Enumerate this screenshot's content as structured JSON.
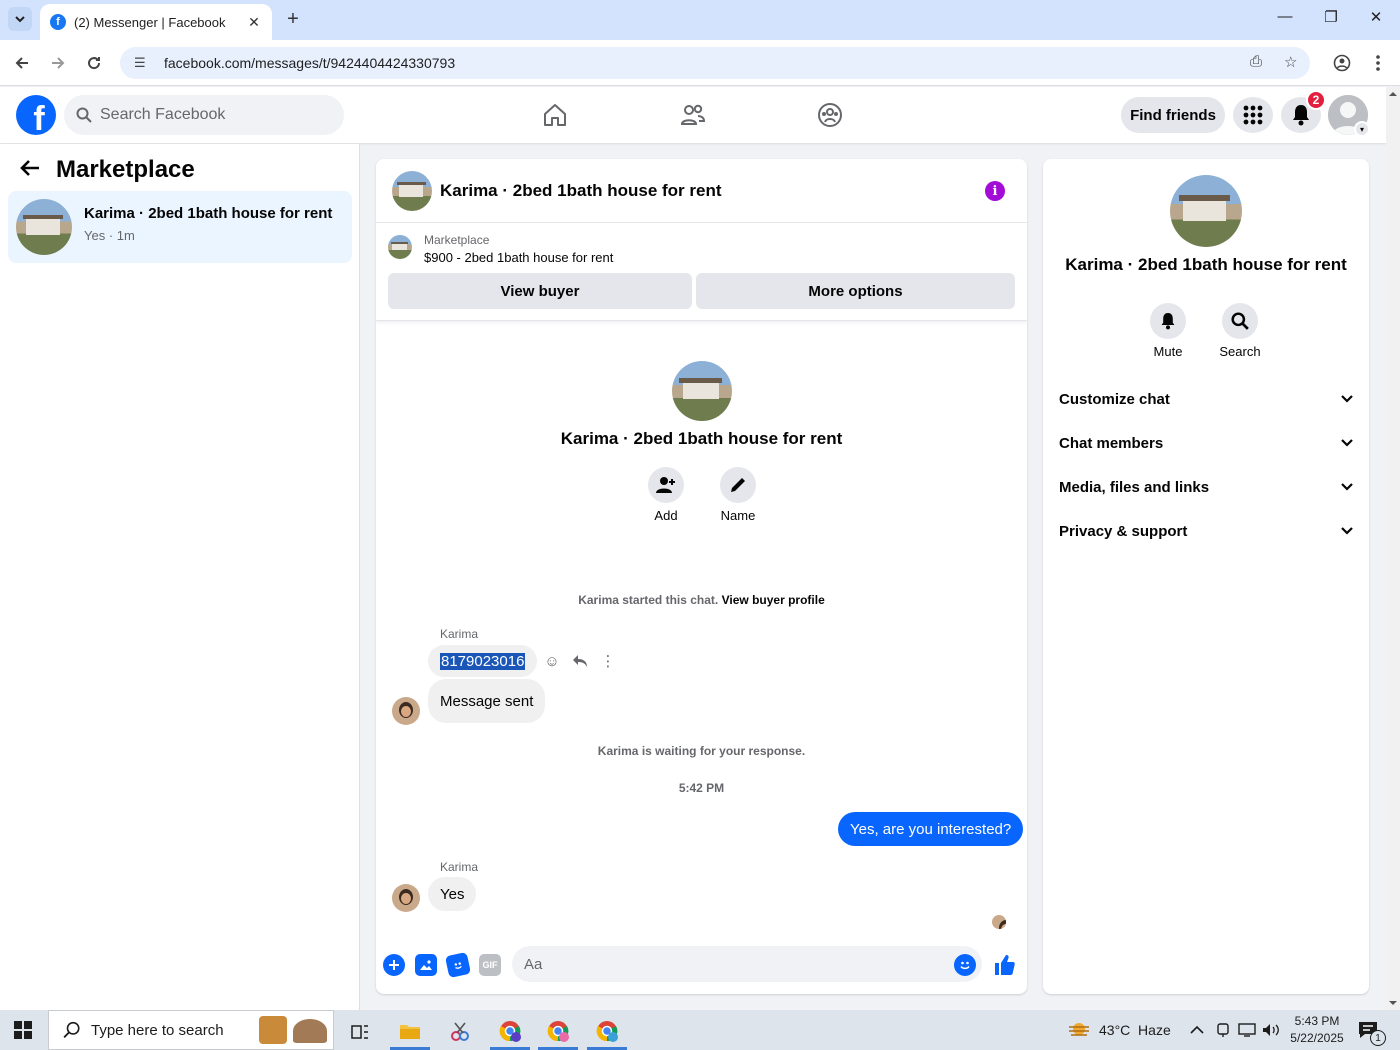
{
  "browser": {
    "tab_title": "(2) Messenger | Facebook",
    "url": "facebook.com/messages/t/9424404424330793"
  },
  "fb_header": {
    "search_placeholder": "Search Facebook",
    "find_friends": "Find friends",
    "notification_count": "2"
  },
  "left": {
    "title": "Marketplace",
    "conversation": {
      "name": "Karima · 2bed 1bath house for rent",
      "preview": "Yes · 1m"
    }
  },
  "chat": {
    "title": "Karima · 2bed 1bath house for rent",
    "marketplace_label": "Marketplace",
    "listing": "$900 - 2bed 1bath house for rent",
    "view_buyer": "View buyer",
    "more_options": "More options",
    "intro_name": "Karima · 2bed 1bath house for rent",
    "add_label": "Add",
    "name_label": "Name",
    "started_text": "Karima started this chat.",
    "view_buyer_profile": "View buyer profile",
    "sender1": "Karima",
    "phone": "8179023016",
    "message_sent": "Message sent",
    "waiting": "Karima is waiting for your response.",
    "time": "5:42 PM",
    "my_message": "Yes, are you interested?",
    "sender2": "Karima",
    "reply": "Yes",
    "composer_placeholder": "Aa"
  },
  "right": {
    "name": "Karima · 2bed 1bath house for rent",
    "mute": "Mute",
    "search": "Search",
    "sections": [
      "Customize chat",
      "Chat members",
      "Media, files and links",
      "Privacy & support"
    ]
  },
  "taskbar": {
    "search_placeholder": "Type here to search",
    "weather": "43°C  Haze",
    "time": "5:43 PM",
    "date": "5/22/2025",
    "notif": "1"
  },
  "colors": {
    "fb_blue": "#0866ff",
    "info_purple": "#a30bd7",
    "badge_red": "#e41e3f"
  }
}
